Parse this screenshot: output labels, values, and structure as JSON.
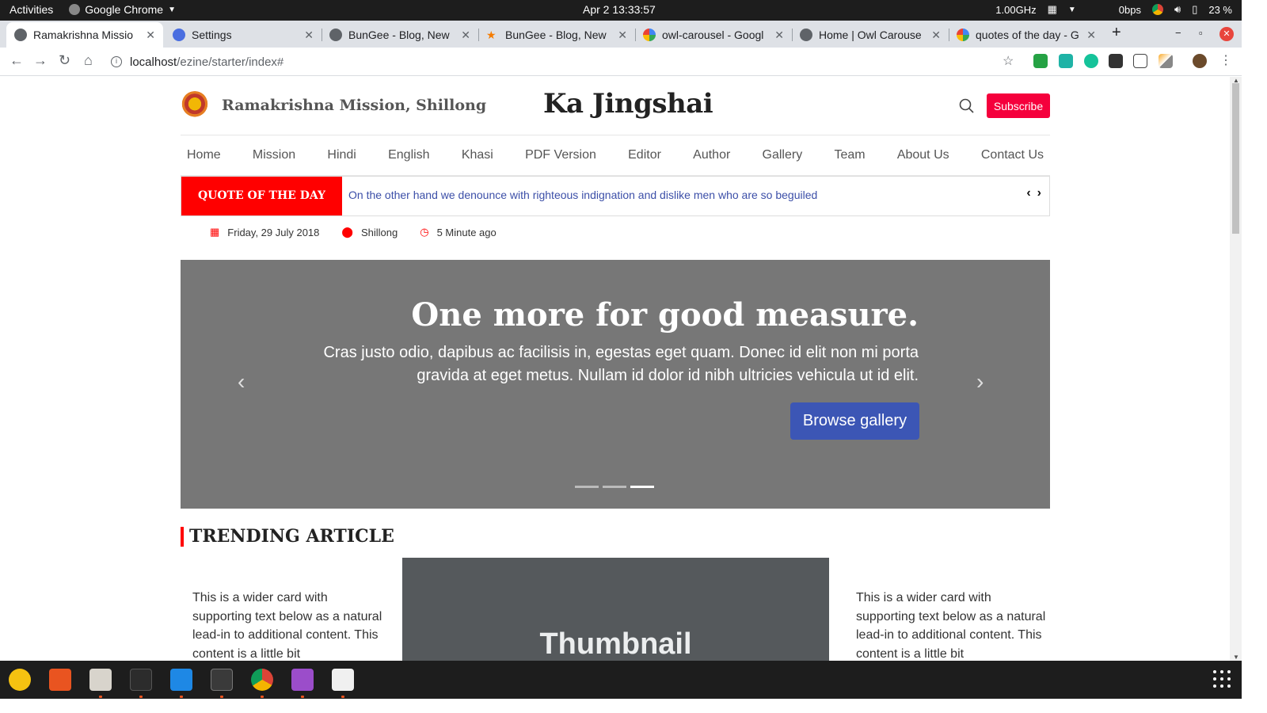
{
  "system": {
    "activities": "Activities",
    "app_name": "Google Chrome",
    "clock": "Apr 2  13:33:57",
    "cpu": "1.00GHz",
    "net": "0bps",
    "battery": "23 %"
  },
  "tabs": [
    {
      "title": "Ramakrishna Missio",
      "active": true
    },
    {
      "title": "Settings"
    },
    {
      "title": "BunGee - Blog, New"
    },
    {
      "title": "BunGee - Blog, New"
    },
    {
      "title": "owl-carousel - Googl"
    },
    {
      "title": "Home | Owl Carouse"
    },
    {
      "title": "quotes of the day - G"
    }
  ],
  "address": {
    "host": "localhost",
    "path": "/ezine/starter/index#"
  },
  "site": {
    "brand_name": "Ramakrishna Mission, Shillong",
    "title": "Ka Jingshai",
    "subscribe_label": "Subscribe"
  },
  "nav": [
    "Home",
    "Mission",
    "Hindi",
    "English",
    "Khasi",
    "PDF Version",
    "Editor",
    "Author",
    "Gallery",
    "Team",
    "About Us",
    "Contact Us"
  ],
  "quote": {
    "label": "QUOTE OF THE DAY",
    "text": "On the other hand we denounce with righteous indignation and dislike men who are so beguiled"
  },
  "meta": {
    "date": "Friday, 29 July 2018",
    "location": "Shillong",
    "time_ago": "5 Minute ago"
  },
  "carousel": {
    "heading": "One more for good measure.",
    "text": "Cras justo odio, dapibus ac facilisis in, egestas eget quam. Donec id elit non mi porta gravida at eget metus. Nullam id dolor id nibh ultricies vehicula ut id elit.",
    "button_label": "Browse gallery",
    "slide_count": 3,
    "active_slide": 3
  },
  "trending": {
    "title": "TRENDING ARTICLE",
    "card_left_text": "This is a wider card with supporting text below as a natural lead-in to additional content. This content is a little bit",
    "thumb_label": "Thumbnail",
    "card_right_text": "This is a wider card with supporting text below as a natural lead-in to additional content. This content is a little bit"
  },
  "colors": {
    "accent_red": "#ff0000",
    "subscribe": "#f5003c",
    "button_blue": "#3c56b5",
    "quote_text": "#3c4fa8"
  }
}
